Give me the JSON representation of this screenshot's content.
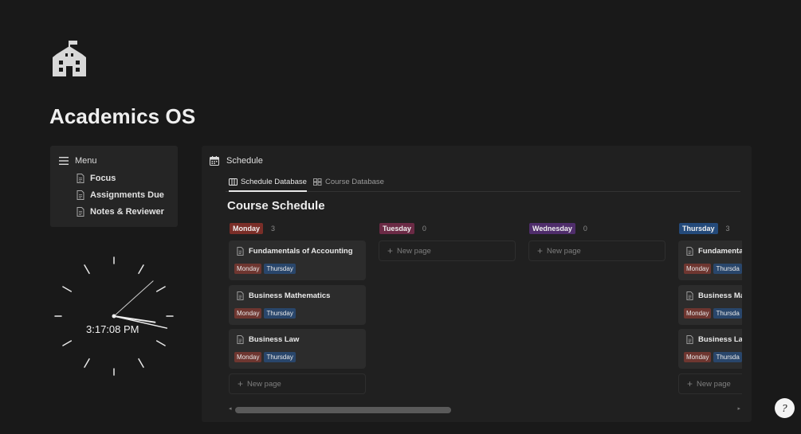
{
  "page": {
    "title": "Academics OS",
    "icon": "school-building-icon"
  },
  "menu": {
    "title": "Menu",
    "icon": "menu-icon",
    "items": [
      {
        "label": "Focus",
        "icon": "document-icon"
      },
      {
        "label": "Assignments Due",
        "icon": "document-icon"
      },
      {
        "label": "Notes & Reviewer",
        "icon": "document-icon"
      }
    ]
  },
  "clock": {
    "time": "3:17:08 PM",
    "hour": 3,
    "minute": 17,
    "second": 8
  },
  "schedule": {
    "title": "Schedule",
    "icon": "calendar-icon",
    "tabs": [
      {
        "label": "Schedule Database",
        "icon": "board-icon",
        "active": true
      },
      {
        "label": "Course Database",
        "icon": "gallery-icon",
        "active": false
      }
    ],
    "view_title": "Course Schedule",
    "new_page_label": "New page",
    "columns": [
      {
        "label": "Monday",
        "count": "3",
        "color": "#7a2e28"
      },
      {
        "label": "Tuesday",
        "count": "0",
        "color": "#6b2a45"
      },
      {
        "label": "Wednesday",
        "count": "0",
        "color": "#4f2d6b"
      },
      {
        "label": "Thursday",
        "count": "3",
        "color": "#244a7a"
      }
    ],
    "monday_cards": [
      {
        "title": "Fundamentals of Accounting",
        "tags": [
          "Monday",
          "Thursday"
        ]
      },
      {
        "title": "Business Mathematics",
        "tags": [
          "Monday",
          "Thursday"
        ]
      },
      {
        "title": "Business Law",
        "tags": [
          "Monday",
          "Thursday"
        ]
      }
    ],
    "thursday_cards": [
      {
        "title": "Fundamental",
        "tags": [
          "Monday",
          "Thursda"
        ]
      },
      {
        "title": "Business Mat",
        "tags": [
          "Monday",
          "Thursda"
        ]
      },
      {
        "title": "Business Law",
        "tags": [
          "Monday",
          "Thursda"
        ]
      }
    ]
  },
  "help": {
    "label": "?",
    "icon": "help-icon"
  }
}
